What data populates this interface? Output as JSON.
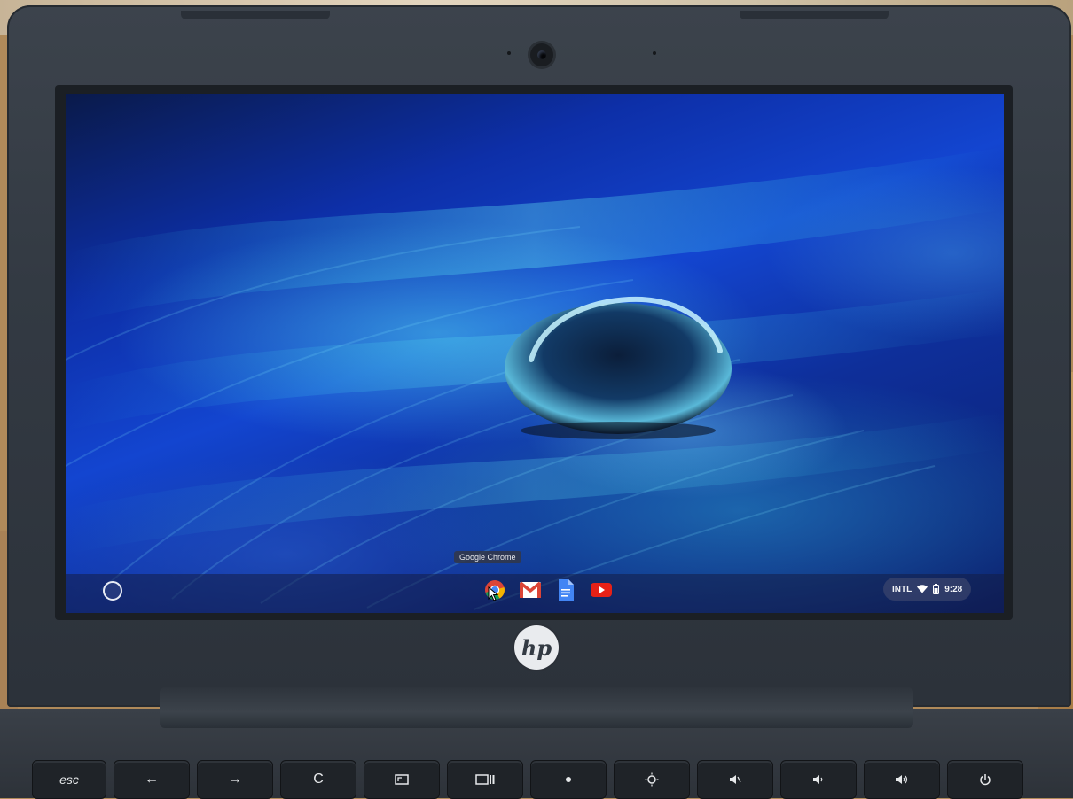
{
  "shelf": {
    "tooltip": "Google Chrome",
    "apps": [
      {
        "name": "Google Chrome",
        "icon": "chrome-icon"
      },
      {
        "name": "Gmail",
        "icon": "gmail-icon"
      },
      {
        "name": "Google Docs",
        "icon": "docs-icon"
      },
      {
        "name": "YouTube",
        "icon": "youtube-icon"
      }
    ],
    "status": {
      "input_method": "INTL",
      "time": "9:28"
    }
  },
  "device": {
    "brand": "hp"
  },
  "keyboard": {
    "keys": [
      "esc",
      "←",
      "→",
      "C",
      "",
      "",
      "",
      "",
      "",
      "",
      "",
      ""
    ]
  },
  "colors": {
    "bezel": "#333a43",
    "wallpaper_primary": "#1345d0",
    "wallpaper_highlight": "#50d2eb",
    "shelf": "#141e46",
    "chrome_red": "#db4437",
    "chrome_yellow": "#f4b400",
    "chrome_green": "#0f9d58",
    "chrome_blue": "#4285f4",
    "youtube_red": "#e62117"
  }
}
